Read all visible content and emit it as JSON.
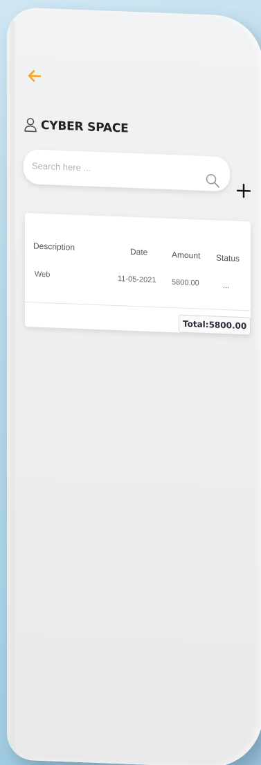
{
  "header": {
    "back_icon": "arrow-left-icon",
    "accent_color": "#F5A623",
    "user_icon": "user-outline-icon",
    "title": "CYBER SPACE"
  },
  "search": {
    "placeholder": "Search here ...",
    "value": "",
    "icon": "search-icon"
  },
  "actions": {
    "add_icon": "plus-icon"
  },
  "table": {
    "columns": [
      "Description",
      "Date",
      "Amount",
      "Status"
    ],
    "rows": [
      {
        "description": "Web",
        "date": "11-05-2021",
        "amount": "5800.00",
        "status": "..."
      }
    ],
    "total": "Total:5800.00"
  }
}
